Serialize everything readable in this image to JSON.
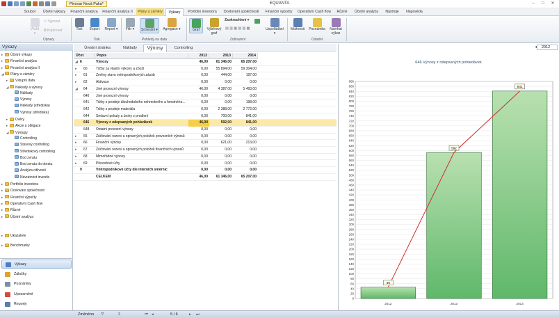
{
  "window": {
    "title": "EQUANTA",
    "doc_name": "Pivovar Nová Paka*"
  },
  "ribbon_tabs": [
    "Soubor",
    "Účetní výkazy",
    "Finanční analýza",
    "Finanční analýza II",
    "Plány a záměry",
    "Výkazy",
    "Portfolio investora",
    "Ocelování společnosti",
    "Finanční výpočty",
    "Operativní Cash flow",
    "Různé",
    "Účetní analýza",
    "Nástroje",
    "Nápověda"
  ],
  "ribbon": {
    "upravy": {
      "caption": "Úpravy",
      "vlozit": "Vložit",
      "vyjmout": "Vyjmout",
      "kopirovat": "Kopírovat"
    },
    "tisk": {
      "caption": "Tisk",
      "tisk": "Tisk",
      "export": "Export",
      "report": "Report"
    },
    "pohledy": {
      "caption": "Pohledy na data",
      "filtr": "Filtr",
      "srovnani": "Srovnání",
      "agregace": "Agregace"
    },
    "zobrazeni": {
      "caption": "Zobrazení",
      "graf": "Graf",
      "vybrovy_graf_1": "Výběrový",
      "vybrovy_graf_2": "graf",
      "zaokrouhleni": "Zaokrouhlení",
      "usporadani": "Uspořádání"
    },
    "ostatni": {
      "caption": "Ostatní",
      "moznosti": "Možnosti",
      "poznamka": "Poznámka",
      "navrhat_1": "Navrhat",
      "navrhat_2": "výkaz"
    }
  },
  "left_pane": {
    "header": "Výkazy",
    "tree": [
      {
        "label": "Účetní výkazy",
        "level": 0,
        "tog": "▸",
        "type": "folder"
      },
      {
        "label": "Finanční analýza",
        "level": 0,
        "tog": "▸",
        "type": "folder"
      },
      {
        "label": "Finanční analýza II",
        "level": 0,
        "tog": "▸",
        "type": "folder"
      },
      {
        "label": "Plány a záměry",
        "level": 0,
        "tog": "◢",
        "type": "folder"
      },
      {
        "label": "Vstupní data",
        "level": 1,
        "tog": "▸",
        "type": "folder"
      },
      {
        "label": "Náklady a výnosy",
        "level": 1,
        "tog": "◢",
        "type": "folder"
      },
      {
        "label": "Náklady",
        "level": 2,
        "tog": "",
        "type": "doc"
      },
      {
        "label": "Výnosy",
        "level": 2,
        "tog": "",
        "type": "doc"
      },
      {
        "label": "Náklady (střediska)",
        "level": 2,
        "tog": "",
        "type": "doc"
      },
      {
        "label": "Výnosy (střediska)",
        "level": 2,
        "tog": "",
        "type": "doc"
      },
      {
        "label": "Úvěry",
        "level": 1,
        "tog": "▸",
        "type": "folder"
      },
      {
        "label": "Akcie a obligace",
        "level": 1,
        "tog": "▸",
        "type": "folder"
      },
      {
        "label": "Výstupy",
        "level": 1,
        "tog": "◢",
        "type": "folder"
      },
      {
        "label": "Controlling",
        "level": 2,
        "tog": "",
        "type": "doc"
      },
      {
        "label": "Stavový controlling",
        "level": 2,
        "tog": "",
        "type": "doc"
      },
      {
        "label": "Střediskový controlling",
        "level": 2,
        "tog": "",
        "type": "doc"
      },
      {
        "label": "Bod zvratu",
        "level": 2,
        "tog": "",
        "type": "doc"
      },
      {
        "label": "Bod zvratu do obratu",
        "level": 2,
        "tog": "",
        "type": "doc"
      },
      {
        "label": "Analýza citlivosti",
        "level": 2,
        "tog": "",
        "type": "doc"
      },
      {
        "label": "Návratnost investic",
        "level": 2,
        "tog": "",
        "type": "doc"
      },
      {
        "label": "Portfolio investora",
        "level": 0,
        "tog": "▸",
        "type": "folder"
      },
      {
        "label": "Ocelování společnosti",
        "level": 0,
        "tog": "▸",
        "type": "folder"
      },
      {
        "label": "Finanční výpočty",
        "level": 0,
        "tog": "▸",
        "type": "folder"
      },
      {
        "label": "Operativní Cash flow",
        "level": 0,
        "tog": "▸",
        "type": "folder"
      },
      {
        "label": "Různé",
        "level": 0,
        "tog": "▸",
        "type": "folder"
      },
      {
        "label": "Účetní analýza",
        "level": 0,
        "tog": "▸",
        "type": "folder"
      }
    ],
    "extra_groups": [
      {
        "label": "Ukazatele"
      },
      {
        "label": "Benchmarky"
      }
    ],
    "nav": [
      {
        "label": "Výkazy",
        "color": "#4d7fbf",
        "active": true
      },
      {
        "label": "Záložky",
        "color": "#e0a12a",
        "active": false
      },
      {
        "label": "Poznámky",
        "color": "#7a8ea6",
        "active": false
      },
      {
        "label": "Upozornění",
        "color": "#d64a3a",
        "active": false
      },
      {
        "label": "Reporty",
        "color": "#5a7fa8",
        "active": false
      }
    ]
  },
  "subtabs": [
    "Úvodní stránka",
    "Náklady",
    "Výnosy",
    "Controlling"
  ],
  "grid": {
    "headers": {
      "ucet": "Účet",
      "popis": "Popis",
      "y2012": "2012",
      "y2013": "2013",
      "y2014": "2014"
    },
    "rows": [
      {
        "tog": "◢",
        "ucet": "6",
        "popis": "Výnosy",
        "v2012": "46,00",
        "v2013": "61 346,00",
        "v2014": "65 207,00",
        "bold": true,
        "indent": 0
      },
      {
        "tog": "▸",
        "ucet": "60",
        "popis": "Tržby za vlastní výkony a zboží",
        "v2012": "0,00",
        "v2013": "55 894,00",
        "v2014": "59 304,00",
        "indent": 1
      },
      {
        "tog": "▸",
        "ucet": "61",
        "popis": "Změny stavu vnitropodnikových zásob",
        "v2012": "0,00",
        "v2013": "444,00",
        "v2014": "197,00",
        "indent": 1
      },
      {
        "tog": "▸",
        "ucet": "62",
        "popis": "Aktivace",
        "v2012": "0,00",
        "v2013": "0,00",
        "v2014": "0,00",
        "indent": 1
      },
      {
        "tog": "◢",
        "ucet": "64",
        "popis": "Jiné provozní výnosy",
        "v2012": "46,00",
        "v2013": "4 387,00",
        "v2014": "5 493,00",
        "indent": 1
      },
      {
        "tog": "",
        "ucet": "640",
        "popis": "Jiné provozní výnosy",
        "v2012": "0,00",
        "v2013": "0,00",
        "v2014": "0,00",
        "indent": 2
      },
      {
        "tog": "",
        "ucet": "641",
        "popis": "Tržby z prodeje dlouhodobého nehmotného a hmotného...",
        "v2012": "0,00",
        "v2013": "0,00",
        "v2014": "198,00",
        "indent": 2
      },
      {
        "tog": "",
        "ucet": "642",
        "popis": "Tržby z prodeje materiálu",
        "v2012": "0,00",
        "v2013": "2 388,00",
        "v2014": "2 772,00",
        "indent": 2
      },
      {
        "tog": "",
        "ucet": "644",
        "popis": "Smluvní pokuty a úroky z prodlení",
        "v2012": "0,00",
        "v2013": "700,00",
        "v2014": "841,00",
        "indent": 2
      },
      {
        "tog": "",
        "ucet": "646",
        "popis": "Výnosy z odepsaných pohledávek",
        "v2012": "46,00",
        "v2013": "592,00",
        "v2014": "841,00",
        "indent": 2,
        "sel": true,
        "bold": true
      },
      {
        "tog": "",
        "ucet": "648",
        "popis": "Ostatní provozní výnosy",
        "v2012": "0,00",
        "v2013": "0,00",
        "v2014": "0,00",
        "indent": 2
      },
      {
        "tog": "▸",
        "ucet": "65",
        "popis": "Zúčtování rezerv a opravných položek provozních výnosů",
        "v2012": "0,00",
        "v2013": "0,00",
        "v2014": "0,00",
        "indent": 1
      },
      {
        "tog": "▸",
        "ucet": "66",
        "popis": "Finanční výnosy",
        "v2012": "0,00",
        "v2013": "621,00",
        "v2014": "213,00",
        "indent": 1
      },
      {
        "tog": "▸",
        "ucet": "67",
        "popis": "Zúčtování rezerv a opravných položek finančních výnosů",
        "v2012": "0,00",
        "v2013": "0,00",
        "v2014": "0,00",
        "indent": 1
      },
      {
        "tog": "▸",
        "ucet": "68",
        "popis": "Mimořádné výnosy",
        "v2012": "0,00",
        "v2013": "0,00",
        "v2014": "0,00",
        "indent": 1
      },
      {
        "tog": "▸",
        "ucet": "69",
        "popis": "Převodové účty",
        "v2012": "0,00",
        "v2013": "0,00",
        "v2014": "0,00",
        "indent": 1
      },
      {
        "tog": "",
        "ucet": "9",
        "popis": "Vnitropodnikové účty dle interních směrnic",
        "v2012": "0,00",
        "v2013": "0,00",
        "v2014": "0,00",
        "bold": true,
        "indent": 0
      },
      {
        "tog": "",
        "ucet": "",
        "popis": "CELKEM",
        "v2012": "46,00",
        "v2013": "61 346,00",
        "v2014": "65 207,00",
        "bold": true,
        "indent": 0
      }
    ]
  },
  "chart_toolbar": {
    "year": "2012",
    "prev": "◂",
    "next": "▸"
  },
  "chart_data": {
    "type": "bar",
    "title": "646 Výnosy z odepsaných pohledávek",
    "categories": [
      "2012",
      "2013",
      "2014"
    ],
    "values": [
      46,
      592,
      841
    ],
    "ylim": [
      0,
      880
    ],
    "yticks": [
      0,
      20,
      40,
      60,
      80,
      100,
      120,
      140,
      160,
      180,
      200,
      220,
      240,
      260,
      280,
      300,
      320,
      340,
      360,
      380,
      400,
      420,
      440,
      460,
      480,
      500,
      520,
      540,
      560,
      580,
      600,
      620,
      640,
      660,
      680,
      700,
      720,
      740,
      760,
      780,
      800,
      820,
      840,
      860,
      880
    ],
    "data_labels": [
      "46",
      "592",
      "841"
    ],
    "overlay_line": true,
    "colors": {
      "bar_top": "#b9e0b0",
      "bar_bottom": "#5fb86a",
      "line": "#d52b2b"
    }
  },
  "status": {
    "mode": "Změněno",
    "page": "5 / 6"
  }
}
